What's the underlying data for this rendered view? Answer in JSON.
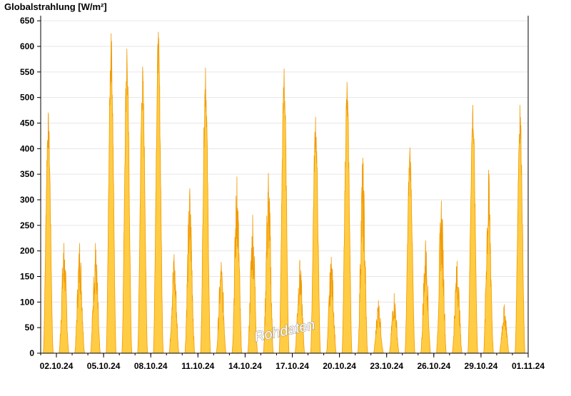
{
  "chart_data": {
    "type": "area",
    "ylabel": "Globalstrahlung [W/m²]",
    "ylim": [
      0,
      660
    ],
    "yticks": [
      0,
      50,
      100,
      150,
      200,
      250,
      300,
      350,
      400,
      450,
      500,
      550,
      600,
      650
    ],
    "x_tick_labels": [
      "02.10.24",
      "05.10.24",
      "08.10.24",
      "11.10.24",
      "14.10.24",
      "17.10.24",
      "20.10.24",
      "23.10.24",
      "26.10.24",
      "29.10.24",
      "01.11.24"
    ],
    "x_tick_day_index": [
      1,
      4,
      7,
      10,
      13,
      16,
      19,
      22,
      25,
      28,
      31
    ],
    "grid": true,
    "series": [
      {
        "color": "#ffcc44",
        "edge_color": "#f29a00",
        "daily_peaks": [
          {
            "date": "01.10.24",
            "peak": 470
          },
          {
            "date": "02.10.24",
            "peak": 215
          },
          {
            "date": "03.10.24",
            "peak": 215
          },
          {
            "date": "04.10.24",
            "peak": 215
          },
          {
            "date": "05.10.24",
            "peak": 625
          },
          {
            "date": "06.10.24",
            "peak": 595
          },
          {
            "date": "07.10.24",
            "peak": 560
          },
          {
            "date": "08.10.24",
            "peak": 628
          },
          {
            "date": "09.10.24",
            "peak": 193
          },
          {
            "date": "10.10.24",
            "peak": 322
          },
          {
            "date": "11.10.24",
            "peak": 558
          },
          {
            "date": "12.10.24",
            "peak": 178
          },
          {
            "date": "13.10.24",
            "peak": 345
          },
          {
            "date": "14.10.24",
            "peak": 270
          },
          {
            "date": "15.10.24",
            "peak": 352
          },
          {
            "date": "16.10.24",
            "peak": 556
          },
          {
            "date": "17.10.24",
            "peak": 182
          },
          {
            "date": "18.10.24",
            "peak": 462
          },
          {
            "date": "19.10.24",
            "peak": 188
          },
          {
            "date": "20.10.24",
            "peak": 530
          },
          {
            "date": "21.10.24",
            "peak": 382
          },
          {
            "date": "22.10.24",
            "peak": 103
          },
          {
            "date": "23.10.24",
            "peak": 117
          },
          {
            "date": "24.10.24",
            "peak": 402
          },
          {
            "date": "25.10.24",
            "peak": 220
          },
          {
            "date": "26.10.24",
            "peak": 298
          },
          {
            "date": "27.10.24",
            "peak": 180
          },
          {
            "date": "28.10.24",
            "peak": 485
          },
          {
            "date": "29.10.24",
            "peak": 358
          },
          {
            "date": "30.10.24",
            "peak": 95
          },
          {
            "date": "31.10.24",
            "peak": 485
          }
        ]
      }
    ]
  },
  "watermark": "Rohdaten"
}
